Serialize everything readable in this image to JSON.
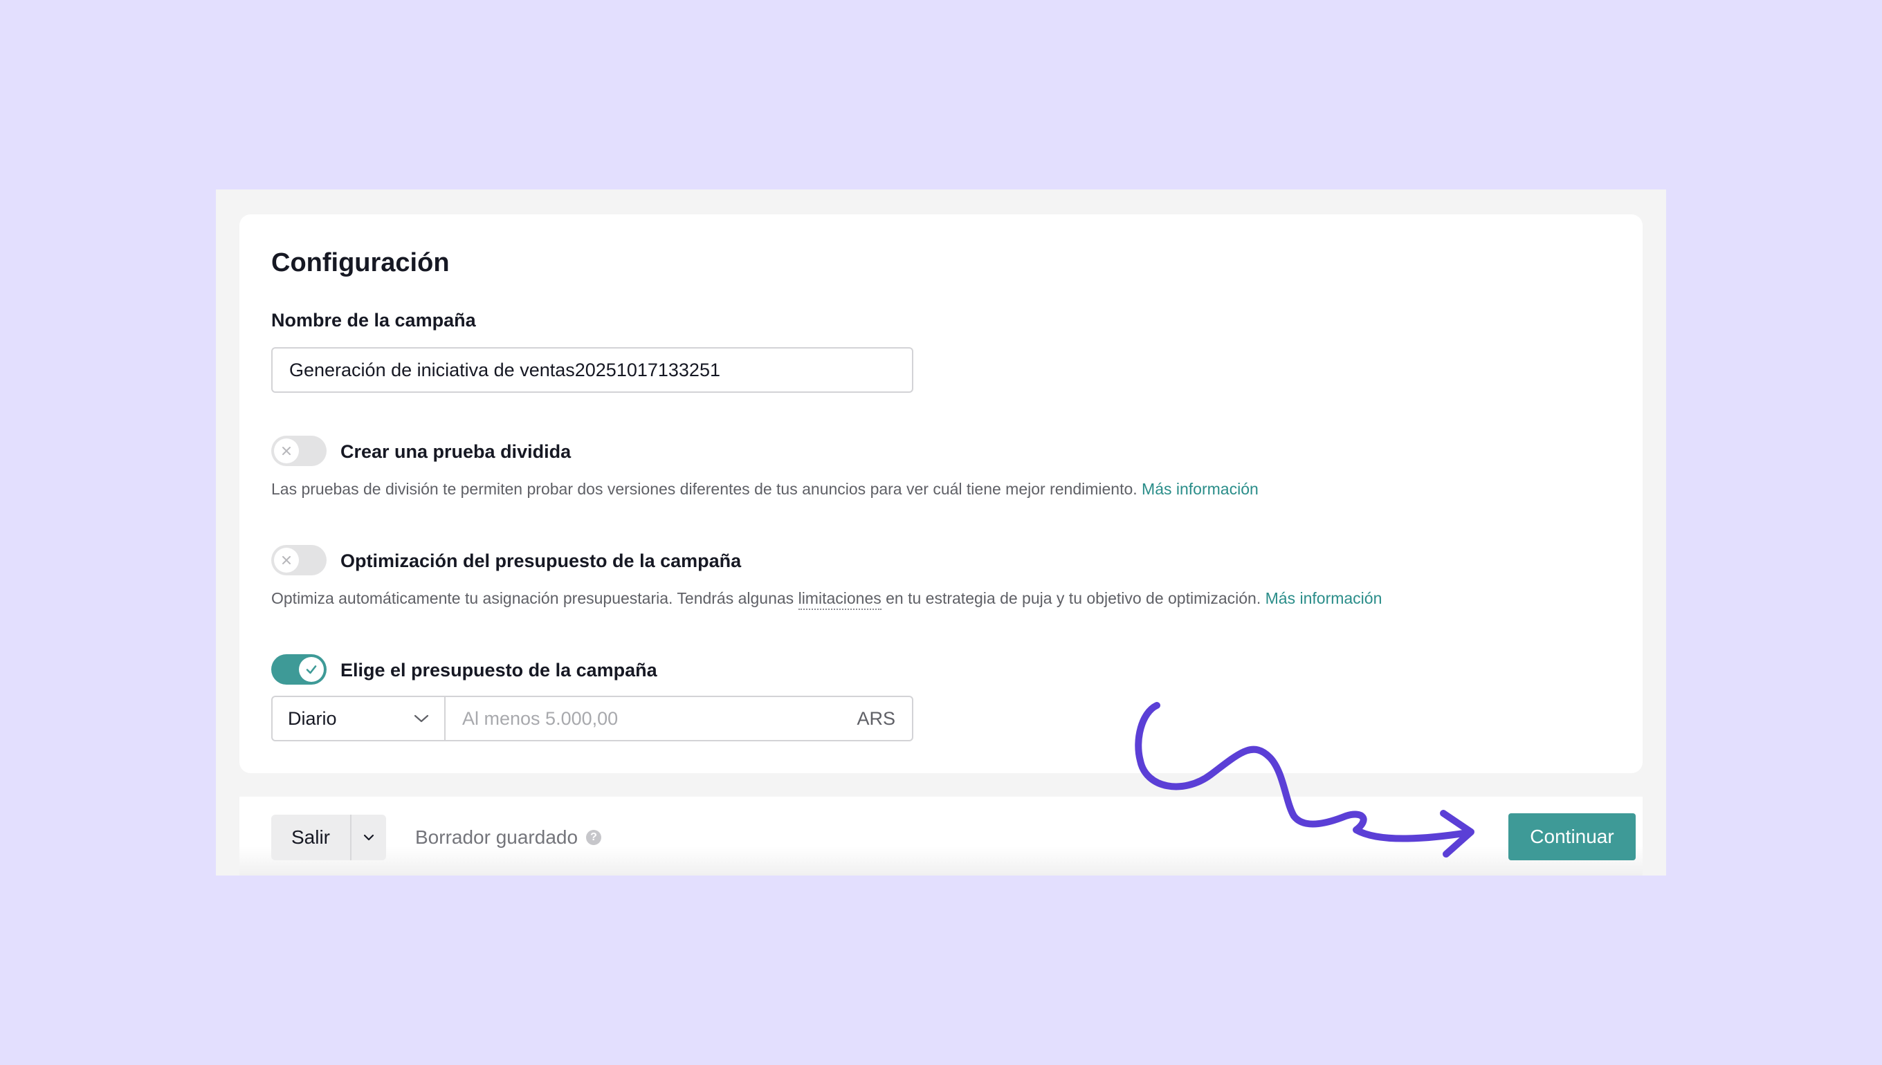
{
  "settings": {
    "title": "Configuración",
    "campaign_name_label": "Nombre de la campaña",
    "campaign_name_value": "Generación de iniciativa de ventas20251017133251",
    "split_test": {
      "label": "Crear una prueba dividida",
      "enabled": false,
      "description": "Las pruebas de división te permiten probar dos versiones diferentes de tus anuncios para ver cuál tiene mejor rendimiento.",
      "link": "Más información"
    },
    "budget_optimization": {
      "label": "Optimización del presupuesto de la campaña",
      "enabled": false,
      "description_before": "Optimiza automáticamente tu asignación presupuestaria. Tendrás algunas",
      "description_term": "limitaciones",
      "description_after": "en tu estrategia de puja y tu objetivo de optimización.",
      "link": "Más información"
    },
    "campaign_budget": {
      "label": "Elige el presupuesto de la campaña",
      "enabled": true,
      "mode_selected": "Diario",
      "amount_placeholder": "Al menos 5.000,00",
      "currency": "ARS"
    }
  },
  "footer": {
    "exit_label": "Salir",
    "draft_status": "Borrador guardado",
    "continue_label": "Continuar"
  },
  "colors": {
    "page_background": "#e3dffe",
    "accent": "#3e9a97",
    "link": "#2a8d89",
    "annotation_arrow": "#5b3fd6"
  },
  "icons": {
    "toggle_off": "x-icon",
    "toggle_on": "check-icon",
    "select": "chevron-down-icon",
    "exit_menu": "chevron-down-icon",
    "draft_help": "question-circle-icon",
    "annotation": "hand-drawn-arrow-icon"
  }
}
